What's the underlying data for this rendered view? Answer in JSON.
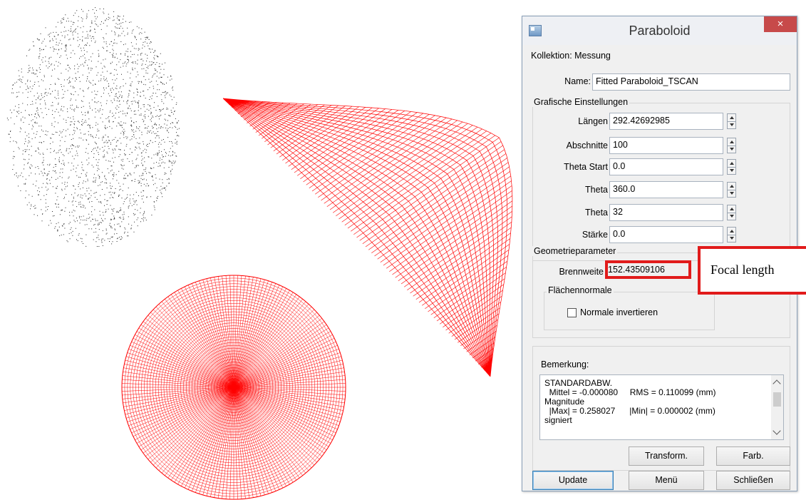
{
  "dialog": {
    "title": "Paraboloid",
    "close_glyph": "×",
    "collection_label": "Kollektion: Messung",
    "name": {
      "label": "Name:",
      "value": "Fitted Paraboloid_TSCAN"
    },
    "graphic_settings": {
      "title": "Grafische Einstellungen",
      "fields": [
        {
          "label": "Längen",
          "value": "292.42692985"
        },
        {
          "label": "Abschnitte",
          "value": "100"
        },
        {
          "label": "Theta Start",
          "value": "0.0"
        },
        {
          "label": "Theta",
          "value": "360.0"
        },
        {
          "label": "Theta",
          "value": "32"
        },
        {
          "label": "Stärke",
          "value": "0.0"
        }
      ]
    },
    "geometry_params": {
      "title": "Geometrieparameter",
      "focal_label": "Brennweite",
      "focal_value": "152.43509106",
      "surface_normal_title": "Flächennormale",
      "invert_normal_label": "Normale invertieren",
      "invert_normal_checked": false
    },
    "remark": {
      "title": "Bemerkung:",
      "lines": [
        "STANDARDABW.",
        "  Mittel = -0.000080     RMS = 0.110099 (mm)",
        "Magnitude",
        "  |Max| = 0.258027      |Min| = 0.000002 (mm)",
        "signiert"
      ]
    },
    "buttons": {
      "transform": "Transform.",
      "color": "Farb.",
      "update": "Update",
      "menu": "Menü",
      "close": "Schließen"
    }
  },
  "annotation": {
    "callout_text": "Focal length",
    "color": "#e11b1b"
  },
  "colors": {
    "point_cloud": "#000000",
    "mesh": "#ff0000"
  }
}
